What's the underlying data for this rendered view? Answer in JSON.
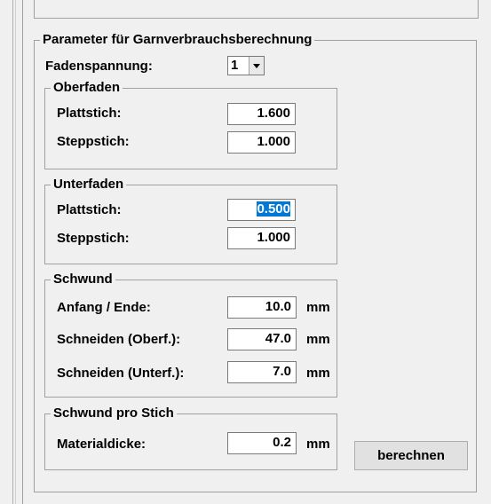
{
  "main_group": {
    "title": "Parameter für Garnverbrauchsberechnung"
  },
  "fadenspannung": {
    "label": "Fadenspannung:",
    "value": "1"
  },
  "oberfaden": {
    "title": "Oberfaden",
    "plattstich": {
      "label": "Plattstich:",
      "value": "1.600"
    },
    "steppstich": {
      "label": "Steppstich:",
      "value": "1.000"
    }
  },
  "unterfaden": {
    "title": "Unterfaden",
    "plattstich": {
      "label": "Plattstich:",
      "value": "0.500"
    },
    "steppstich": {
      "label": "Steppstich:",
      "value": "1.000"
    }
  },
  "schwund": {
    "title": "Schwund",
    "anfang_ende": {
      "label": "Anfang / Ende:",
      "value": "10.0",
      "unit": "mm"
    },
    "schneiden_oberf": {
      "label": "Schneiden (Oberf.):",
      "value": "47.0",
      "unit": "mm"
    },
    "schneiden_unterf": {
      "label": "Schneiden (Unterf.):",
      "value": "7.0",
      "unit": "mm"
    }
  },
  "schwund_pro_stich": {
    "title": "Schwund pro Stich",
    "materialdicke": {
      "label": "Materialdicke:",
      "value": "0.2",
      "unit": "mm"
    }
  },
  "berechnen_button": "berechnen"
}
